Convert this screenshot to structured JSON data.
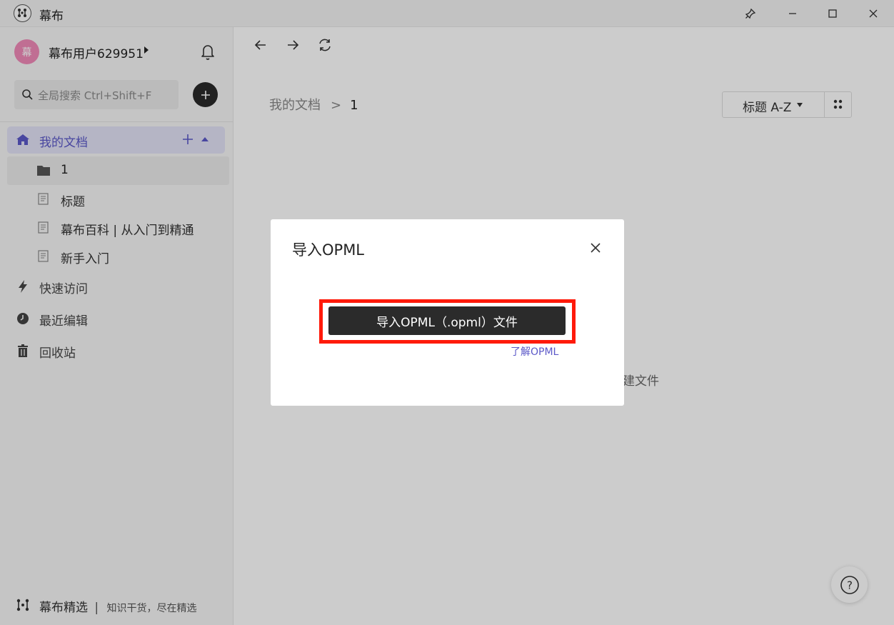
{
  "window": {
    "title": "幕布",
    "controls": [
      "pin",
      "minimize",
      "maximize",
      "close"
    ]
  },
  "sidebar": {
    "user": {
      "avatar_char": "幕",
      "name": "幕布用户629951"
    },
    "search": {
      "placeholder": "全局搜索 Ctrl+Shift+F"
    },
    "my_docs": {
      "label": "我的文档"
    },
    "tree": [
      {
        "type": "folder",
        "label": "1"
      },
      {
        "type": "doc",
        "label": "标题"
      },
      {
        "type": "doc",
        "label": "幕布百科 | 从入门到精通"
      },
      {
        "type": "doc",
        "label": "新手入门"
      }
    ],
    "nav": [
      {
        "icon": "lightning-icon",
        "label": "快速访问"
      },
      {
        "icon": "clock-icon",
        "label": "最近编辑"
      },
      {
        "icon": "trash-icon",
        "label": "回收站"
      }
    ],
    "footer": {
      "title": "幕布精选",
      "separator": "|",
      "subtitle": "知识干货，尽在精选"
    }
  },
  "main": {
    "breadcrumb": {
      "root": "我的文档",
      "separator": ">",
      "current": "1"
    },
    "sort": {
      "label": "标题 A-Z"
    },
    "background_hint": "建文件",
    "help_label": "?"
  },
  "dialog": {
    "title": "导入OPML",
    "import_button": "导入OPML（.opml）文件",
    "learn_link": "了解OPML"
  },
  "colors": {
    "accent": "#5b58c8",
    "highlight_frame": "#ff1a0a",
    "button_dark": "#2b2b2b",
    "avatar": "#f08ab8"
  }
}
